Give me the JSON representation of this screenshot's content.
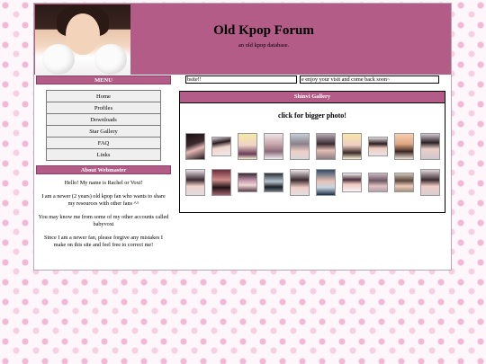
{
  "header": {
    "title": "Old Kpop Forum",
    "subtitle": "an old kpop database."
  },
  "sidebar": {
    "menu_heading": "MENU",
    "menu_items": [
      {
        "label": "Home"
      },
      {
        "label": "Profiles"
      },
      {
        "label": "Downloads"
      },
      {
        "label": "Star Gallery"
      },
      {
        "label": "FAQ"
      },
      {
        "label": "Links"
      }
    ],
    "about_heading": "About Webmaster",
    "about_paragraphs": [
      "Hello! My name is Rachel or Voxi!",
      "I am a newer (2 years) old kpop fan who wants to share my resources with other fans ^^",
      "You may know me from some of my other accounts called babyvoxi",
      "Since I am a newer fan, please forgive any mistakes I make on this site and feel free to correct me!"
    ]
  },
  "marquees": [
    {
      "text": "bsite!!"
    },
    {
      "text": "e enjoy your visit and come back soon~"
    }
  ],
  "gallery": {
    "heading": "Shinvi Gallery",
    "note": "click for bigger photo!"
  },
  "colors": {
    "accent": "#b35c88",
    "page_background": "#fdf6fa"
  }
}
